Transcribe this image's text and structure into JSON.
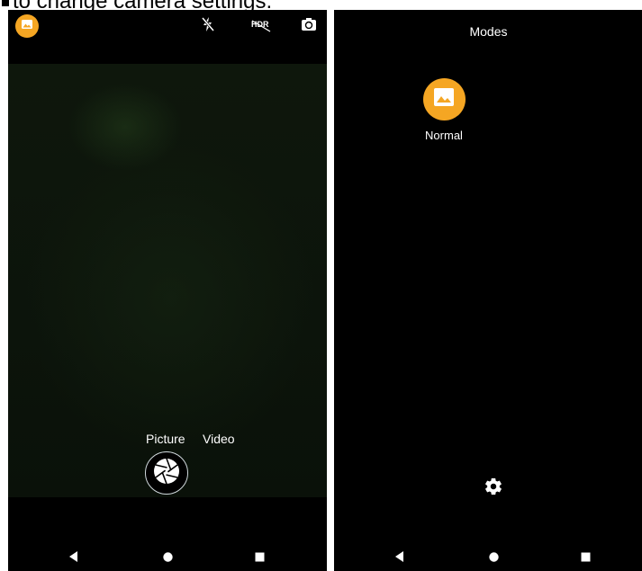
{
  "caption": {
    "text": "to change camera settings."
  },
  "left_screen": {
    "top_bar": {
      "mode_icon": "image-icon",
      "flash_icon": "flash-off-icon",
      "hdr_icon": "hdr-off-icon",
      "hdr_text": "HDR",
      "switch_camera_icon": "switch-camera-icon"
    },
    "modes": {
      "picture": "Picture",
      "video": "Video"
    },
    "shutter_icon": "shutter-icon"
  },
  "right_screen": {
    "title": "Modes",
    "items": [
      {
        "label": "Normal",
        "icon": "image-icon"
      }
    ],
    "settings_icon": "gear-icon"
  },
  "navbar": {
    "back": "back-icon",
    "home": "home-icon",
    "recents": "recents-icon"
  },
  "colors": {
    "accent": "#f5a623",
    "background": "#000000",
    "text": "#ffffff"
  }
}
